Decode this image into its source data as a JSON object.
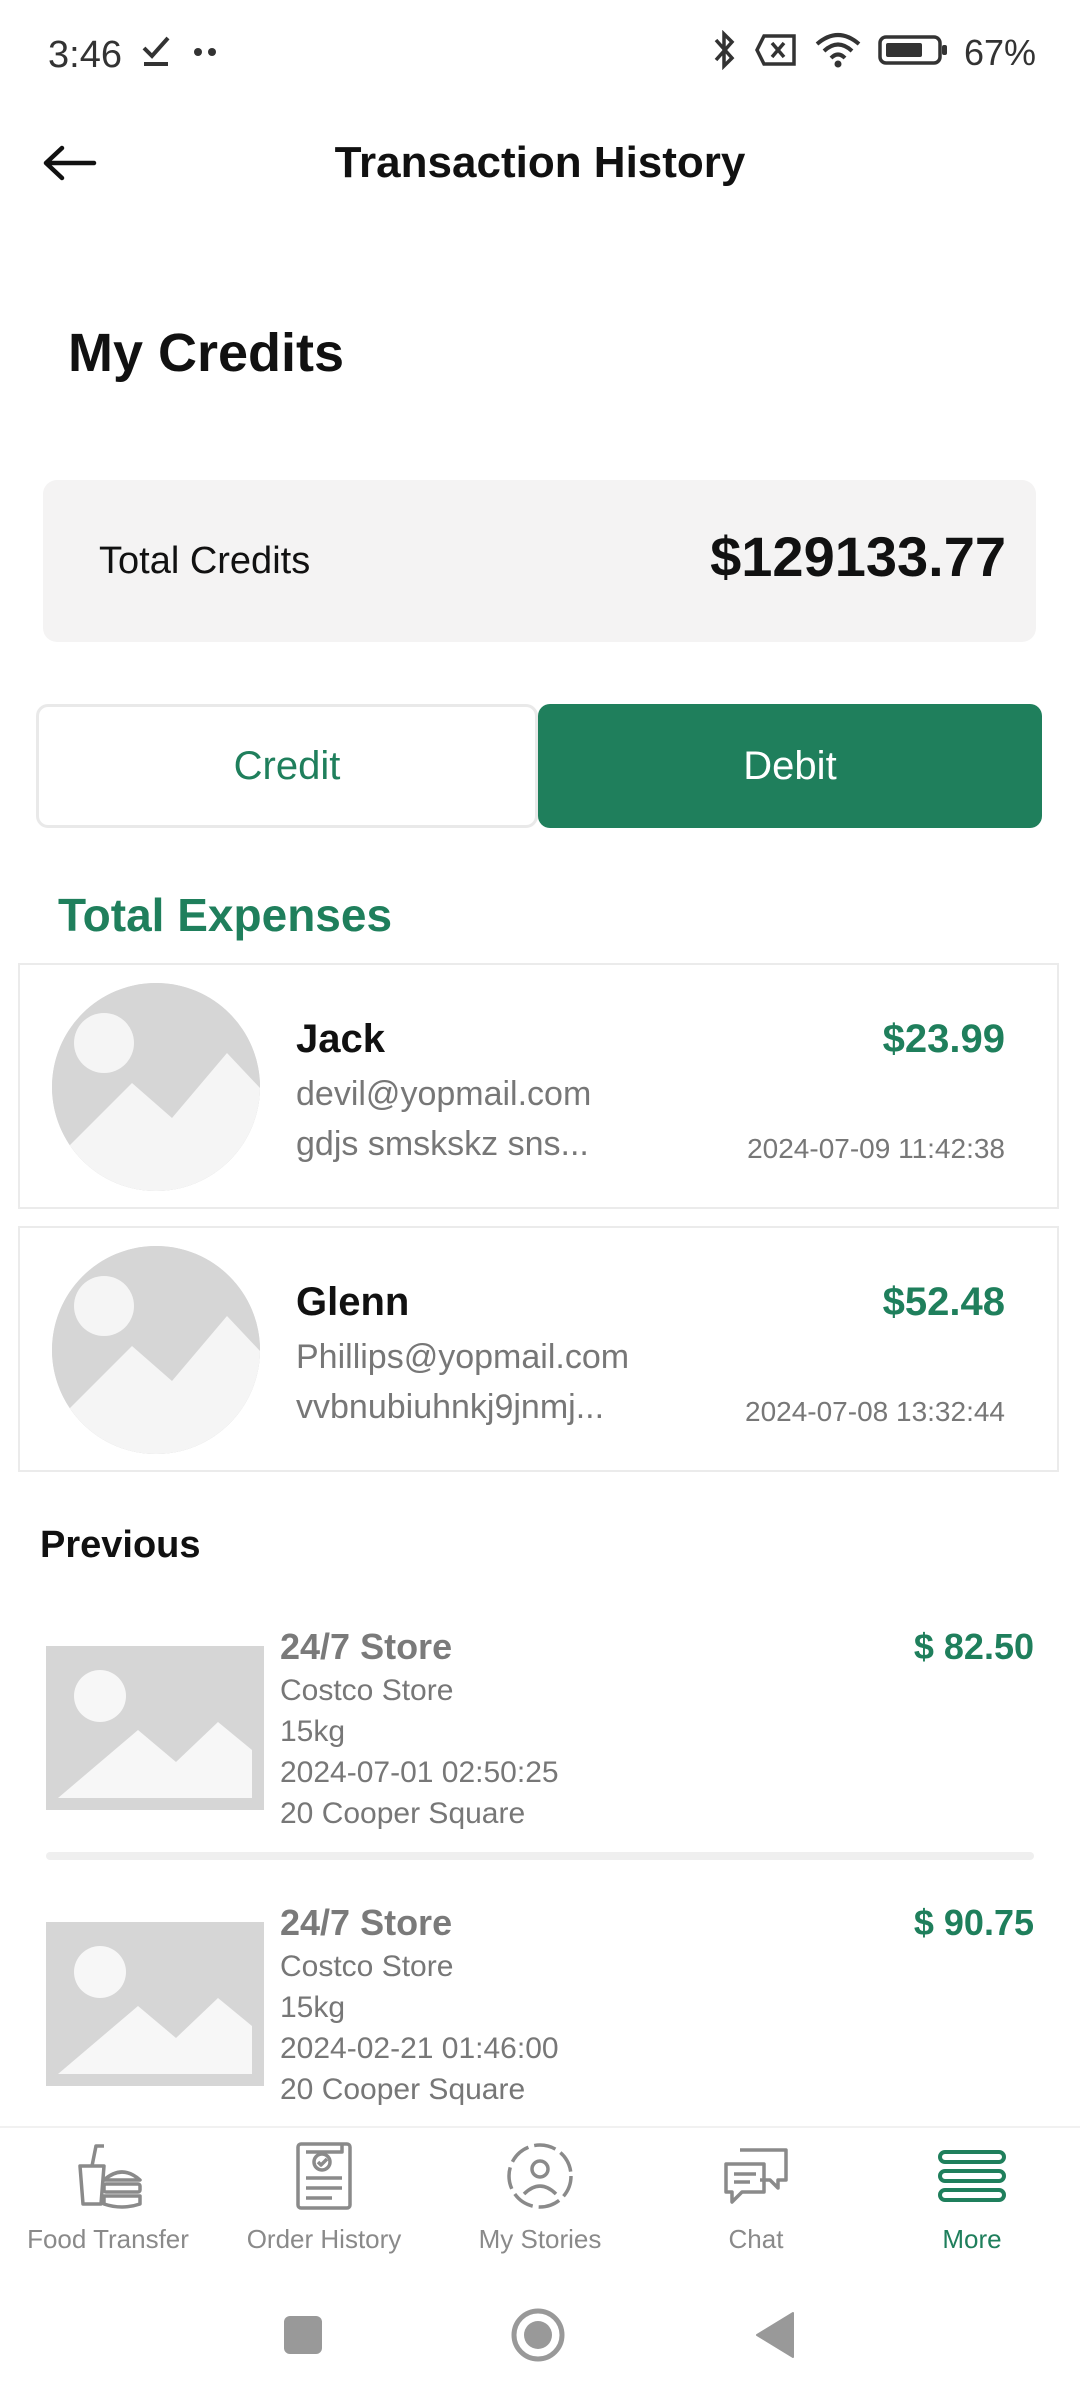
{
  "status_bar": {
    "time": "3:46",
    "battery": "67%",
    "icons": [
      "check-icon",
      "dots-icon",
      "bluetooth-icon",
      "sim-icon",
      "wifi-icon",
      "battery-icon"
    ]
  },
  "app_bar": {
    "title": "Transaction History",
    "back_icon": "arrow-left-icon"
  },
  "credits": {
    "section_title": "My Credits",
    "label": "Total Credits",
    "value": "$129133.77"
  },
  "tabs": [
    {
      "label": "Credit",
      "active": false
    },
    {
      "label": "Debit",
      "active": true
    }
  ],
  "expenses": {
    "title": "Total Expenses",
    "items": [
      {
        "name": "Jack",
        "email": "devil@yopmail.com",
        "description": "gdjs smskskz sns...",
        "amount": "$23.99",
        "date": "2024-07-09 11:42:38"
      },
      {
        "name": "Glenn",
        "email": "Phillips@yopmail.com",
        "description": "vvbnubiuhnkj9jnmj...",
        "amount": "$52.48",
        "date": "2024-07-08 13:32:44"
      }
    ]
  },
  "previous": {
    "title": "Previous",
    "items": [
      {
        "name": "24/7 Store",
        "store": "Costco Store",
        "weight": "15kg",
        "datetime": "2024-07-01 02:50:25",
        "address": "20 Cooper Square",
        "amount": "$ 82.50"
      },
      {
        "name": "24/7 Store",
        "store": "Costco Store",
        "weight": "15kg",
        "datetime": "2024-02-21 01:46:00",
        "address": "20 Cooper Square",
        "amount": "$ 90.75"
      }
    ]
  },
  "bottom_nav": [
    {
      "label": "Food Transfer",
      "icon": "food-transfer-icon",
      "active": false
    },
    {
      "label": "Order History",
      "icon": "order-history-icon",
      "active": false
    },
    {
      "label": "My Stories",
      "icon": "stories-icon",
      "active": false
    },
    {
      "label": "Chat",
      "icon": "chat-icon",
      "active": false
    },
    {
      "label": "More",
      "icon": "menu-icon",
      "active": true
    }
  ],
  "colors": {
    "accent": "#1f7f5c",
    "card_bg": "#f4f3f3",
    "muted_text": "#777777"
  }
}
